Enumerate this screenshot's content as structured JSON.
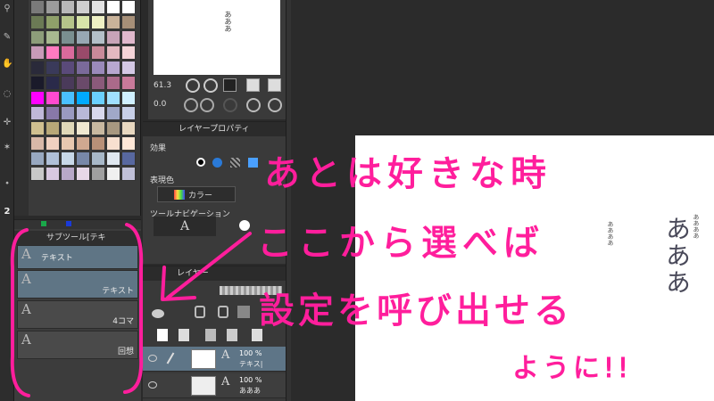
{
  "colors": {
    "annotation": "#ff1e9c",
    "selection": "#5f7585"
  },
  "swatches": [
    "#7a7a7a",
    "#9c9c9c",
    "#b8b8b8",
    "#cfcfcf",
    "#e3e3e3",
    "#ffffff",
    "#ffffff",
    "#6b7a55",
    "#8fa06a",
    "#b5c48a",
    "#d7e4a9",
    "#eef0c4",
    "#c9b39a",
    "#a68f78",
    "#8d9d7a",
    "#a8b890",
    "#7a8f90",
    "#98a8b4",
    "#b4c0c8",
    "#c8a4b8",
    "#e0b8cc",
    "#c89ab8",
    "#ff7ac0",
    "#d96a9c",
    "#9a4a6a",
    "#c98a9a",
    "#e3b8c0",
    "#f4d4d8",
    "#2a2a3a",
    "#3a3a5a",
    "#5a4a7a",
    "#7a6a9a",
    "#9a8aba",
    "#b8a8d0",
    "#d4c8e4",
    "#1a1a2a",
    "#2a2a4a",
    "#4a3a5a",
    "#6a4a6a",
    "#8a5a7a",
    "#aa6a8a",
    "#c87a9a",
    "#ff00ff",
    "#ff4ad0",
    "#4ac0ff",
    "#00aaff",
    "#6ad0ff",
    "#a0e0ff",
    "#d0f0ff",
    "#c0b8d8",
    "#8878a8",
    "#9a9ac0",
    "#b8b8d8",
    "#d8d8ec",
    "#a0a8c8",
    "#c8d0e8",
    "#d0c090",
    "#b8a878",
    "#e0d8b8",
    "#f0e8d0",
    "#c8b8a0",
    "#a89880",
    "#e8d8c0",
    "#d8b8a8",
    "#f0d0c0",
    "#e8c8b0",
    "#d0a890",
    "#b89078",
    "#f8e0d0",
    "#ffe8d8",
    "#98a8c0",
    "#b0c0d8",
    "#c8d8e8",
    "#7888a8",
    "#a8b8c8",
    "#e0e8f0",
    "#5868a0",
    "#c8c8c8",
    "#d8c8e0",
    "#b8a8c8",
    "#e8d8e8",
    "#a0a0a0",
    "#f0f0f0",
    "#c0c0d8"
  ],
  "subtool": {
    "header": "サブツール[テキ",
    "items": [
      {
        "label": "テキスト",
        "glyph": "A",
        "selected": true
      },
      {
        "label": "テキスト",
        "glyph": "A",
        "selected": false
      },
      {
        "label": "4コマ",
        "glyph": "A",
        "selected": false
      },
      {
        "label": "回想",
        "glyph": "A",
        "selected": false
      }
    ],
    "number": "2"
  },
  "navigator": {
    "canvas_text": "あああ",
    "zoom": "61.3",
    "angle": "0.0"
  },
  "layer_property": {
    "tab": "レイヤープロパティ",
    "effect_label": "効果",
    "color_label": "表現色",
    "color_value": "カラー",
    "toolnav_label": "ツールナビゲーション",
    "toolnav_glyph": "A"
  },
  "layers": {
    "tab": "レイヤー",
    "rows": [
      {
        "opacity": "100 %",
        "name": "テキス|",
        "glyph": "A",
        "selected": true
      },
      {
        "opacity": "100 %",
        "name": "あああ",
        "glyph": "A",
        "selected": false
      }
    ]
  },
  "document": {
    "big_text": "あああ",
    "small_text_1": "ああああ",
    "small_text_2": "ああああ"
  },
  "annotation": {
    "line1": "あとは好きな時",
    "line2": "ここから選べば",
    "line3": "設定を呼び出せる",
    "line4": "ように!!"
  }
}
